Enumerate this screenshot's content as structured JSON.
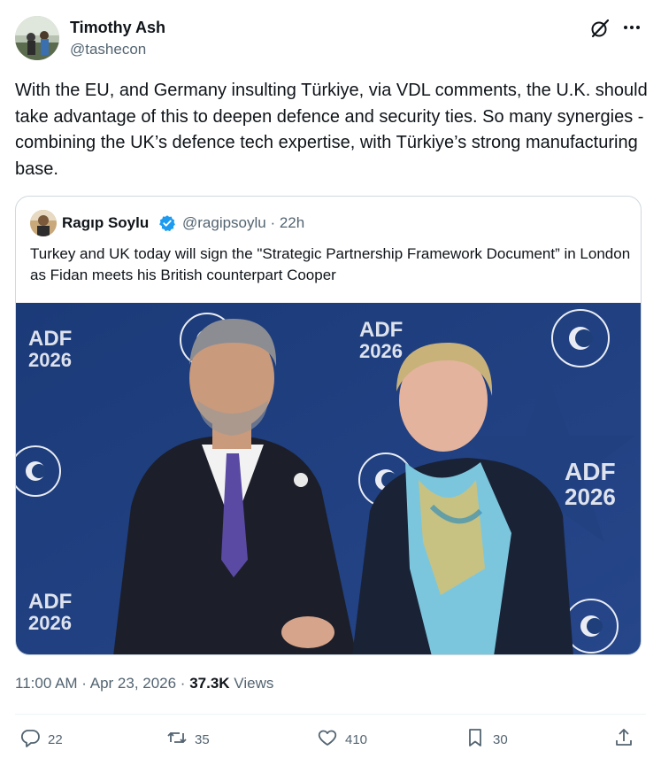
{
  "author": {
    "name": "Timothy Ash",
    "handle": "@tashecon"
  },
  "tweet_text": "With the EU, and Germany insulting Türkiye, via VDL comments, the U.K. should take advantage of this to deepen defence and security ties. So many synergies - combining the UK’s defence tech expertise, with Türkiye’s strong manufacturing base.",
  "quoted": {
    "name": "Ragıp Soylu",
    "handle_time": "@ragipsoylu · 22h",
    "text": "Turkey and UK today will sign the \"Strategic Partnership Framework Document” in London as Fidan meets his British counterpart Cooper",
    "photo_signage": [
      "ADF",
      "2026"
    ]
  },
  "meta": {
    "timestamp": "11:00 AM · Apr 23, 2026 · ",
    "views_count": "37.3K",
    "views_label": " Views"
  },
  "actions": {
    "reply": "22",
    "retweet": "35",
    "like": "410",
    "bookmark": "30"
  },
  "icons": {
    "grok": "grok-icon",
    "more": "more-icon",
    "verified": "verified-badge-icon",
    "reply": "reply-icon",
    "retweet": "retweet-icon",
    "like": "heart-icon",
    "bookmark": "bookmark-icon",
    "share": "share-icon"
  },
  "colors": {
    "text": "#0f1419",
    "secondary": "#536471",
    "border": "#cfd9de",
    "verified": "#1d9bf0",
    "backdrop": "#1e3f7a"
  }
}
